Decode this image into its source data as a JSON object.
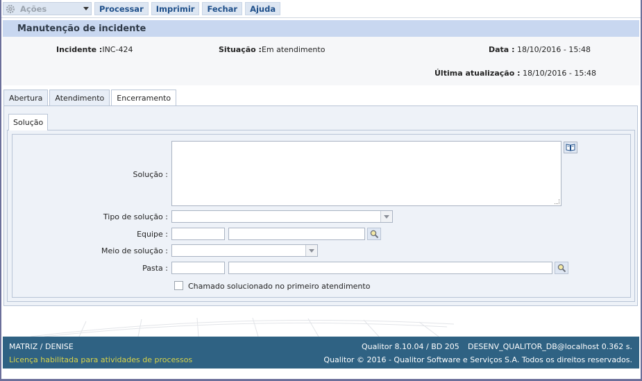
{
  "toolbar": {
    "acoes": "Ações",
    "buttons": [
      "Processar",
      "Imprimir",
      "Fechar",
      "Ajuda"
    ]
  },
  "page": {
    "title": "Manutenção de incidente"
  },
  "info": {
    "incidente_label": "Incidente :",
    "incidente_value": "INC-424",
    "situacao_label": "Situação :",
    "situacao_value": "Em atendimento",
    "data_label": "Data :",
    "data_value": "18/10/2016 - 15:48",
    "atualizacao_label": "Última atualização :",
    "atualizacao_value": "18/10/2016 - 15:48"
  },
  "tabs": [
    "Abertura",
    "Atendimento",
    "Encerramento"
  ],
  "active_tab": "Encerramento",
  "subtab": "Solução",
  "form": {
    "solucao_label": "Solução :",
    "tipo_label": "Tipo de solução :",
    "equipe_label": "Equipe :",
    "meio_label": "Meio de solução :",
    "pasta_label": "Pasta :",
    "checkbox_label": "Chamado solucionado no primeiro atendimento",
    "solucao_value": "",
    "tipo_value": "",
    "equipe_code": "",
    "equipe_name": "",
    "meio_value": "",
    "pasta_code": "",
    "pasta_name": "",
    "checked": false
  },
  "footer": {
    "user": "MATRIZ / DENISE",
    "license": "Licença habilitada para atividades de processos",
    "version": "Qualitor 8.10.04 / BD 205",
    "db": "DESENV_QUALITOR_DB@localhost",
    "time": "0.362 s.",
    "copyright": "Qualitor © 2016 - Qualitor Software e Serviços S.A. Todos os direitos reservados."
  },
  "colors": {
    "toolbar_text": "#1e4f8a",
    "title_bar": "#c8d7f0",
    "footer_bg": "#2f6283",
    "license_text": "#d8d34a"
  }
}
